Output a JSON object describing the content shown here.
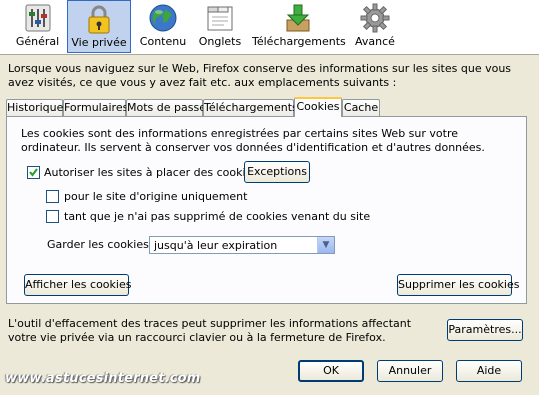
{
  "toolbar": {
    "items": [
      {
        "label": "Général",
        "icon": "general-sliders-icon"
      },
      {
        "label": "Vie privée",
        "icon": "padlock-icon"
      },
      {
        "label": "Contenu",
        "icon": "globe-icon"
      },
      {
        "label": "Onglets",
        "icon": "tabs-window-icon"
      },
      {
        "label": "Téléchargements",
        "icon": "download-arrow-icon"
      },
      {
        "label": "Avancé",
        "icon": "gear-icon"
      }
    ],
    "selected": "Vie privée"
  },
  "intro_text": "Lorsque vous naviguez sur le Web, Firefox conserve des informations sur les sites que vous avez visités, ce que vous y avez fait etc. aux emplacements suivants :",
  "tabs": [
    "Historique",
    "Formulaires",
    "Mots de passe",
    "Téléchargements",
    "Cookies",
    "Cache"
  ],
  "selected_tab": "Cookies",
  "cookies": {
    "description": "Les cookies sont des informations enregistrées par certains sites Web sur votre ordinateur. Ils servent à conserver vos données d'identification et d'autres données.",
    "allow_label": "Autoriser les sites à placer des cookies",
    "allow_checked": true,
    "exceptions_button": "Exceptions",
    "origin_only_label": "pour le site d'origine uniquement",
    "origin_only_checked": false,
    "until_deleted_label": "tant que je n'ai pas supprimé de cookies venant du site",
    "until_deleted_checked": false,
    "keep_label": "Garder les cookies :",
    "keep_value": "jusqu'à leur expiration",
    "show_button": "Afficher les cookies",
    "delete_button": "Supprimer les cookies"
  },
  "footer_text": "L'outil d'effacement des traces peut supprimer les informations affectant votre vie privée via un raccourci clavier ou à la fermeture de Firefox.",
  "settings_button": "Paramètres...",
  "dialog_buttons": {
    "ok": "OK",
    "cancel": "Annuler",
    "help": "Aide"
  },
  "watermark": "www.astucesinternet.com",
  "colors": {
    "selected_toolbar": "#c1d2ee",
    "dialog_bg": "#ece9d8",
    "tab_highlight": "#ffc83c"
  }
}
